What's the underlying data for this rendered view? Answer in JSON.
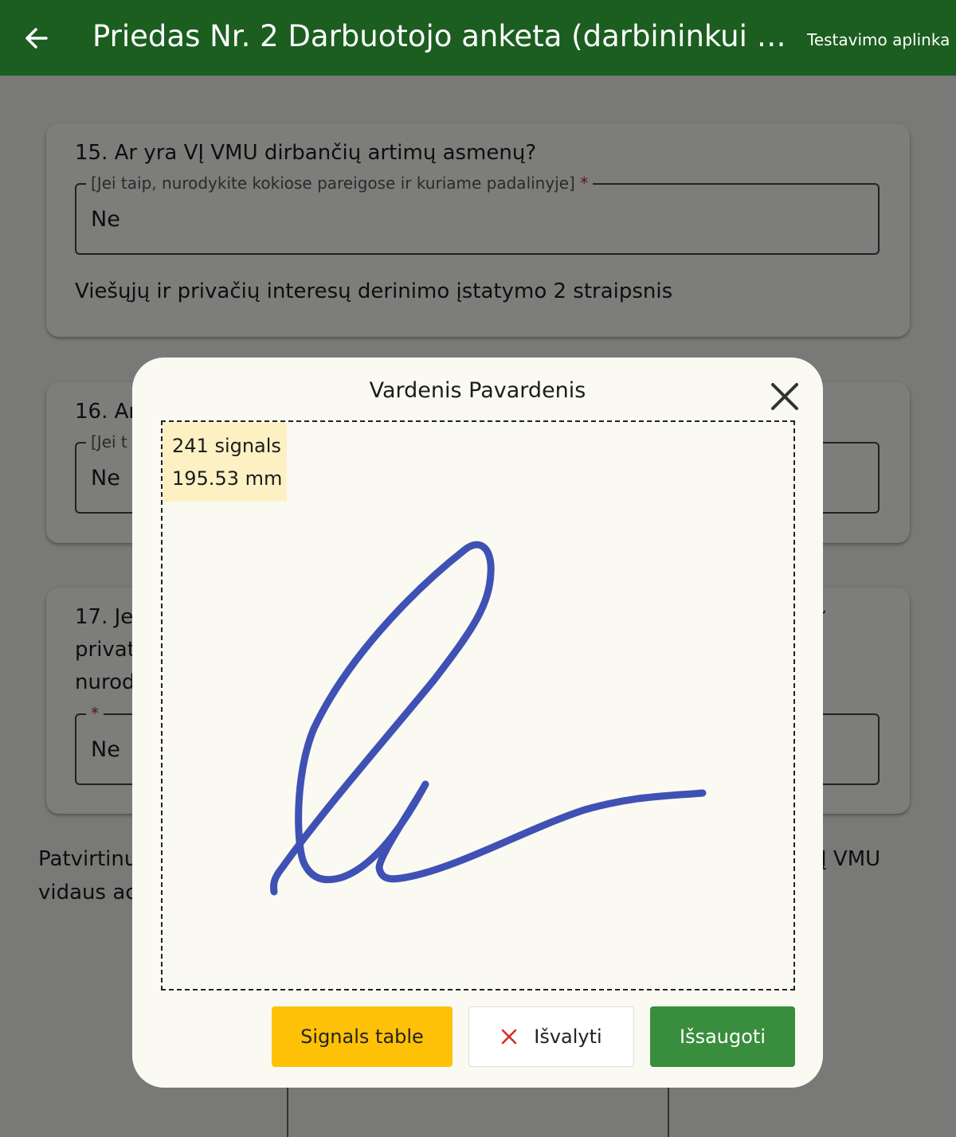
{
  "appbar": {
    "title": "Priedas Nr. 2 Darbuotojo anketa (darbininkui p...",
    "environment": "Testavimo aplinka",
    "back_icon": "arrow-left-icon"
  },
  "questions": [
    {
      "title": "15. Ar yra VĮ VMU dirbančių artimų asmenų?",
      "field_label": "[Jei taip, nurodykite kokiose pareigose ir kuriame padalinyje]",
      "required_mark": "*",
      "value": "Ne",
      "note": "Viešųjų ir privačių interesų derinimo įstatymo 2 straipsnis"
    },
    {
      "title": "16. Ar",
      "field_label": "[Jei t",
      "value": "Ne"
    },
    {
      "title_lines": [
        "17. Je",
        "privat",
        "nurod"
      ],
      "required_mark": "*",
      "value": "Ne",
      "partial_right": "ĩ"
    }
  ],
  "confirm_text": {
    "line1_left": "Patvirtinu",
    "line2_left": "vidaus ac",
    "line1_right": "Į VMU"
  },
  "dialog": {
    "title": "Vardenis Pavardenis",
    "close_icon": "close-icon",
    "stats": {
      "signals": "241 signals",
      "length": "195.53 mm"
    },
    "signature_color": "#3f51b5",
    "buttons": {
      "signals_table": "Signals table",
      "clear": "Išvalyti",
      "clear_icon": "close-icon",
      "save": "Išsaugoti"
    }
  },
  "colors": {
    "appbar": "#1b5e20",
    "signals_button": "#ffc107",
    "save_button": "#388e3c",
    "clear_icon": "#d32f2f"
  }
}
